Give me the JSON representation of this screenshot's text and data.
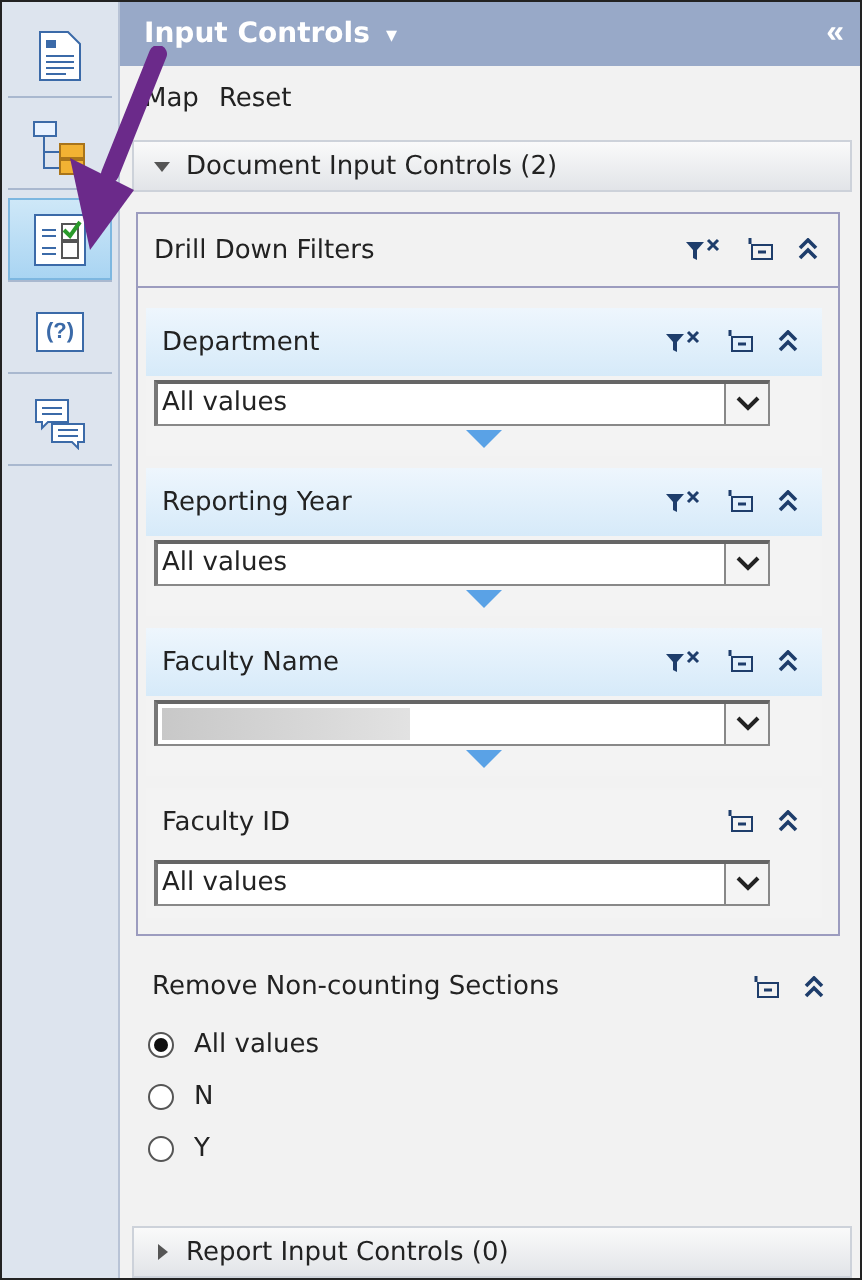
{
  "panel": {
    "title": "Input Controls",
    "title_caret": "▾",
    "collapse": "«"
  },
  "sidebar": {
    "items": [
      {
        "kind": "document",
        "selected": false
      },
      {
        "kind": "tree",
        "selected": false
      },
      {
        "kind": "checklist",
        "selected": true
      },
      {
        "kind": "help",
        "label": "(?)",
        "selected": false
      },
      {
        "kind": "comments",
        "selected": false
      }
    ]
  },
  "toolbar": [
    "Map",
    "Reset"
  ],
  "document_section": {
    "label": "Document Input Controls (2)",
    "expanded": true
  },
  "group": {
    "title": "Drill Down Filters",
    "filters": [
      {
        "label": "Department",
        "value": "All values",
        "redacted": false,
        "clear_icon": true,
        "highlighted": true,
        "expand_marker": true
      },
      {
        "label": "Reporting Year",
        "value": "All values",
        "redacted": false,
        "clear_icon": true,
        "highlighted": true,
        "expand_marker": true
      },
      {
        "label": "Faculty Name",
        "redacted": true,
        "clear_icon": true,
        "highlighted": true,
        "expand_marker": true
      },
      {
        "label": "Faculty ID",
        "value": "All values",
        "redacted": false,
        "clear_icon": false,
        "highlighted": false,
        "expand_marker": false
      }
    ]
  },
  "radio_control": {
    "title": "Remove Non-counting Sections",
    "options": [
      {
        "label": "All values",
        "selected": true
      },
      {
        "label": "N",
        "selected": false
      },
      {
        "label": "Y",
        "selected": false
      }
    ]
  },
  "report_section": {
    "label": "Report Input Controls (0)",
    "expanded": false
  }
}
